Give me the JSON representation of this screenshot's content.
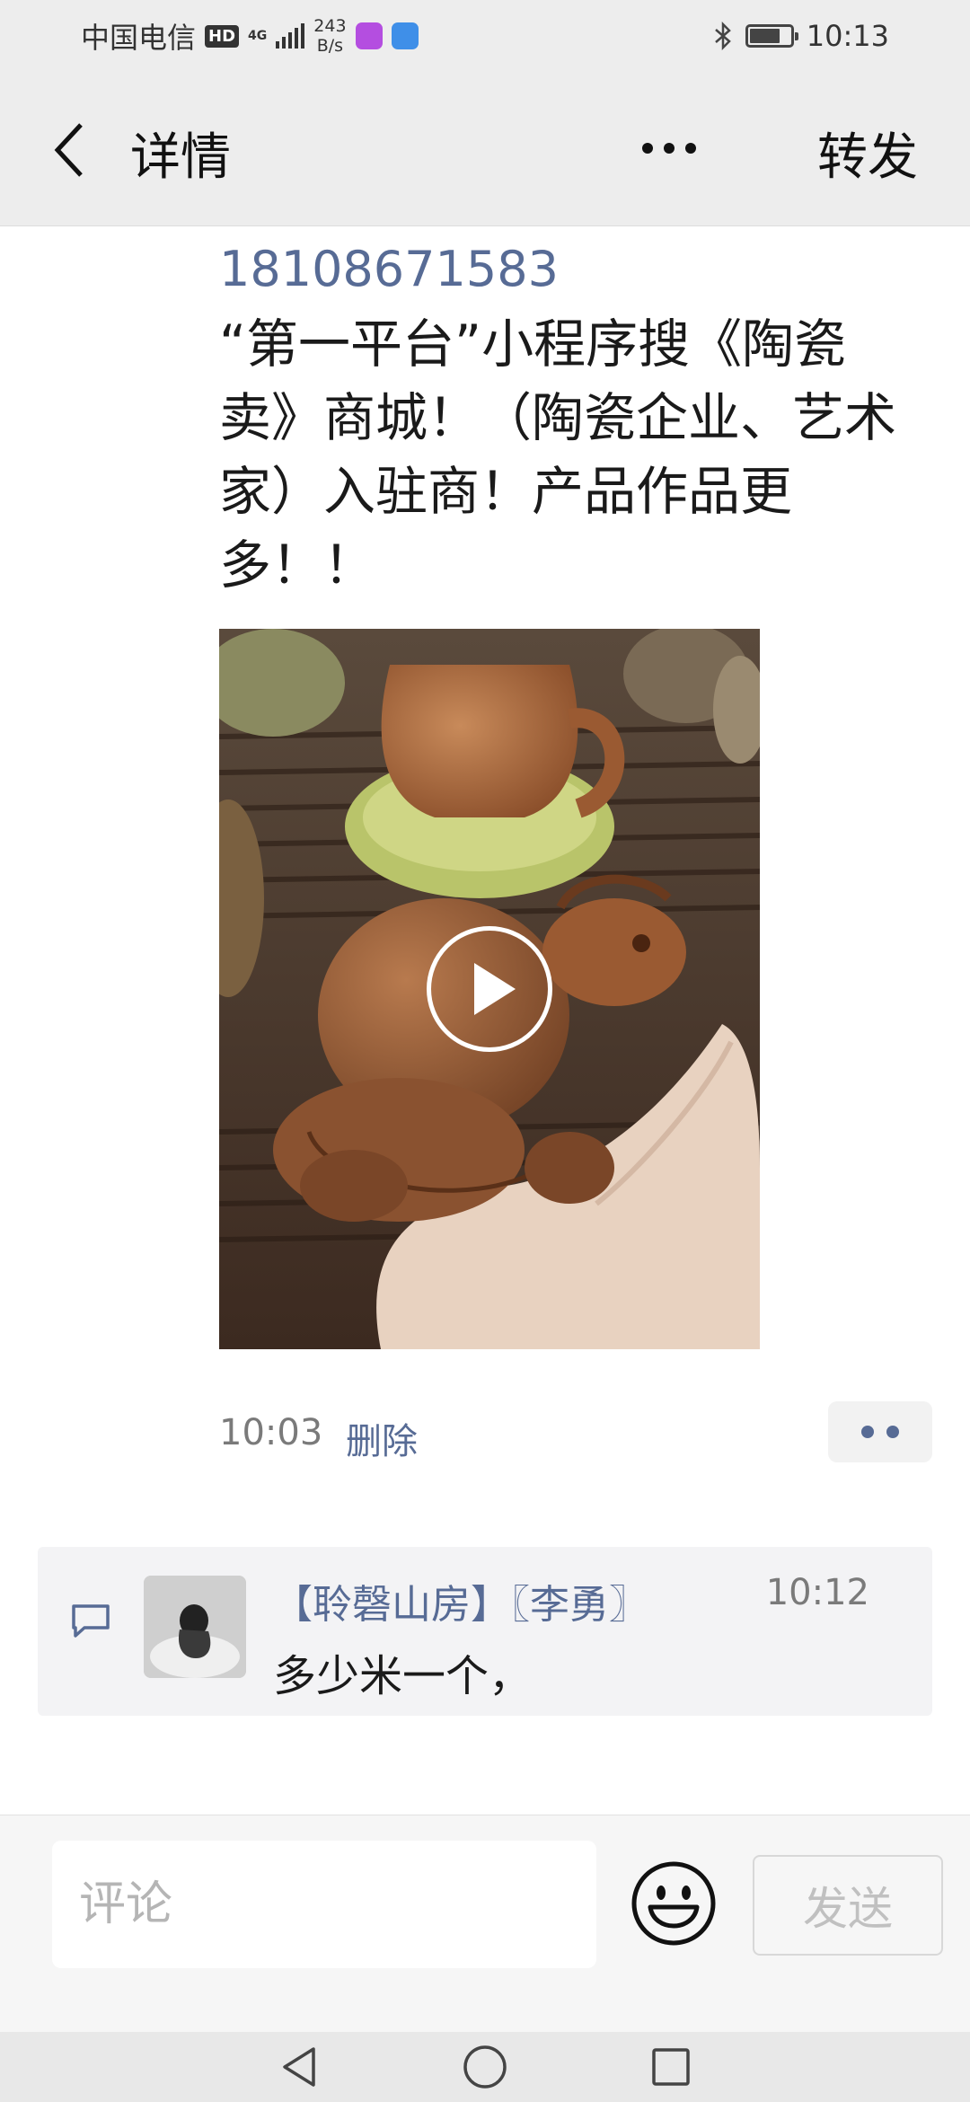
{
  "status_bar": {
    "carrier": "中国电信",
    "hd": "HD",
    "network": "4G",
    "speed_value": "243",
    "speed_unit": "B/s",
    "time": "10:13",
    "battery_level": 0.75
  },
  "header": {
    "back_icon": "chevron-left-icon",
    "title": "详情",
    "more_icon": "more-dots-icon",
    "forward_label": "转发"
  },
  "post": {
    "contact": "18108671583",
    "text": "“第一平台”小程序搜《陶瓷卖》商城！（陶瓷企业、艺术家）入驻商！产品作品更多！！",
    "video_play_icon": "play-icon",
    "time": "10:03",
    "delete_label": "删除",
    "action_icon": "more-dots-icon"
  },
  "comments": [
    {
      "name": "【聆磬山房】〖李勇〗",
      "time": "10:12",
      "text": "多少米一个，"
    }
  ],
  "input_bar": {
    "placeholder": "评论",
    "emoji_icon": "smiley-icon",
    "send_label": "发送"
  },
  "nav_bar": {
    "back_icon": "triangle-back-icon",
    "home_icon": "circle-home-icon",
    "recent_icon": "square-recent-icon"
  },
  "colors": {
    "link": "#576b95",
    "header_bg": "#ededed"
  }
}
